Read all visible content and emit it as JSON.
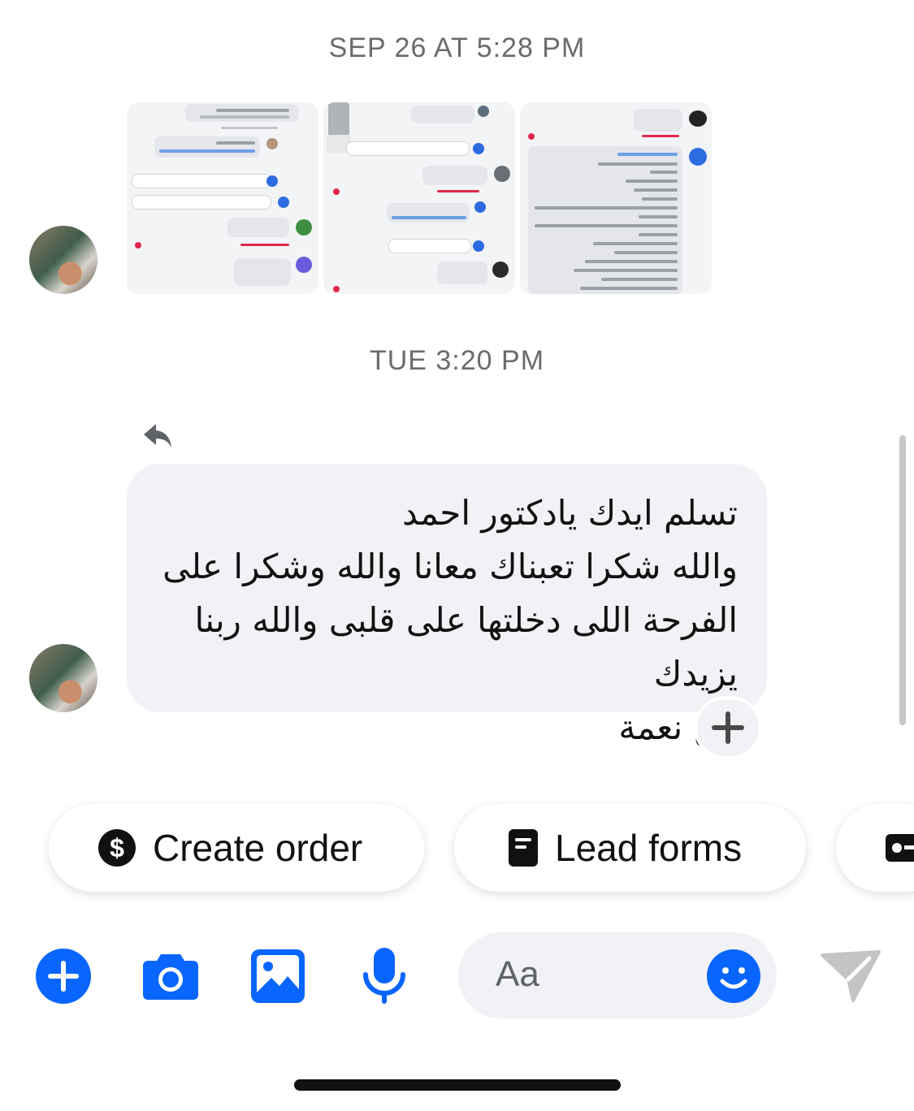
{
  "conversation": {
    "timestamps": {
      "first": "SEP 26 AT 5:28 PM",
      "second": "TUE 3:20 PM"
    },
    "incoming_message": {
      "text": "تسلم ايدك يادكتور احمد\nوالله شكرا تعبناك معانا والله وشكرا على\nالفرحة اللى دخلتها على قلبى والله ربنا يزيدك\nمن نعمة"
    }
  },
  "quick_actions": {
    "create_order": {
      "label": "Create order",
      "icon": "dollar-icon"
    },
    "lead_forms": {
      "label": "Lead forms",
      "icon": "form-icon"
    },
    "partial": {
      "icon": "ticket-icon"
    }
  },
  "composer": {
    "placeholder": "Aa",
    "icons": [
      "plus-icon",
      "camera-icon",
      "gallery-icon",
      "mic-icon",
      "emoji-icon",
      "send-icon"
    ]
  },
  "colors": {
    "accent": "#0866ff",
    "bubble": "#f1f2f6",
    "timestamp": "#6b6b6b"
  }
}
